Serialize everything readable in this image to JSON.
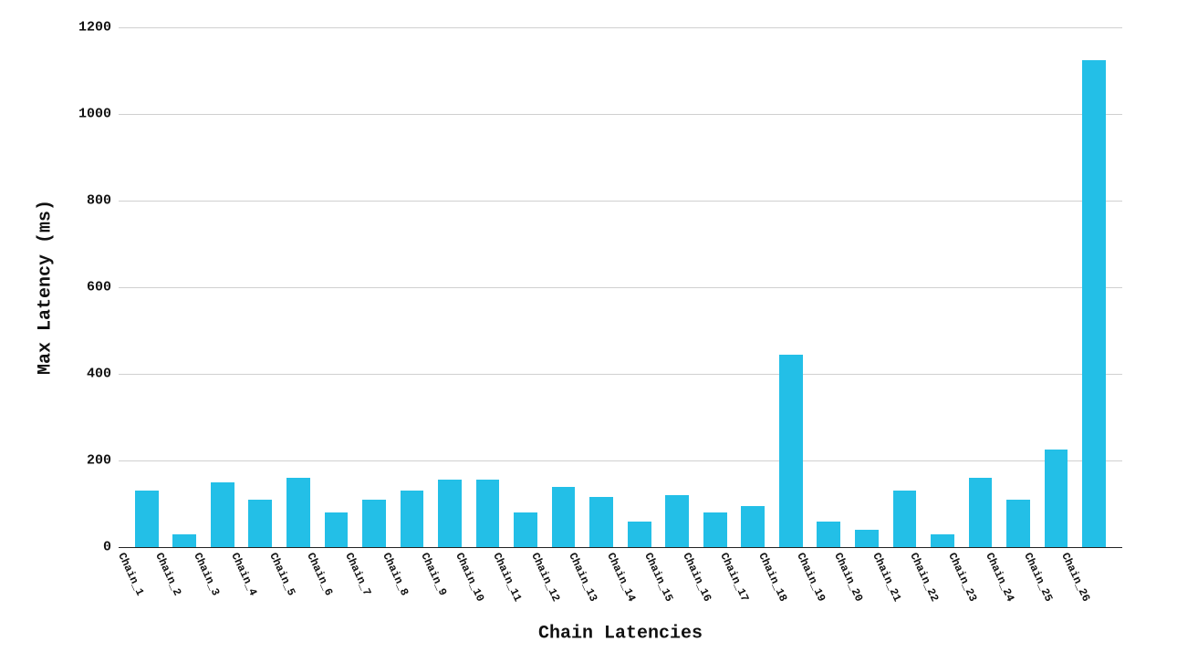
{
  "chart_data": {
    "type": "bar",
    "title": "",
    "xlabel": "Chain Latencies",
    "ylabel": "Max Latency (ms)",
    "ylim": [
      0,
      1200
    ],
    "y_ticks": [
      0,
      200,
      400,
      600,
      800,
      1000,
      1200
    ],
    "bar_color": "#23bfe7",
    "categories": [
      "Chain_1",
      "Chain_2",
      "Chain_3",
      "Chain_4",
      "Chain_5",
      "Chain_6",
      "Chain_7",
      "Chain_8",
      "Chain_9",
      "Chain_10",
      "Chain_11",
      "Chain_12",
      "Chain_13",
      "Chain_14",
      "Chain_15",
      "Chain_16",
      "Chain_17",
      "Chain_18",
      "Chain_19",
      "Chain_20",
      "Chain_21",
      "Chain_22",
      "Chain_23",
      "Chain_24",
      "Chain_25",
      "Chain_26"
    ],
    "values": [
      130,
      30,
      150,
      110,
      160,
      80,
      110,
      130,
      155,
      155,
      80,
      140,
      115,
      60,
      120,
      80,
      95,
      445,
      60,
      40,
      130,
      30,
      160,
      110,
      225,
      1125
    ]
  }
}
